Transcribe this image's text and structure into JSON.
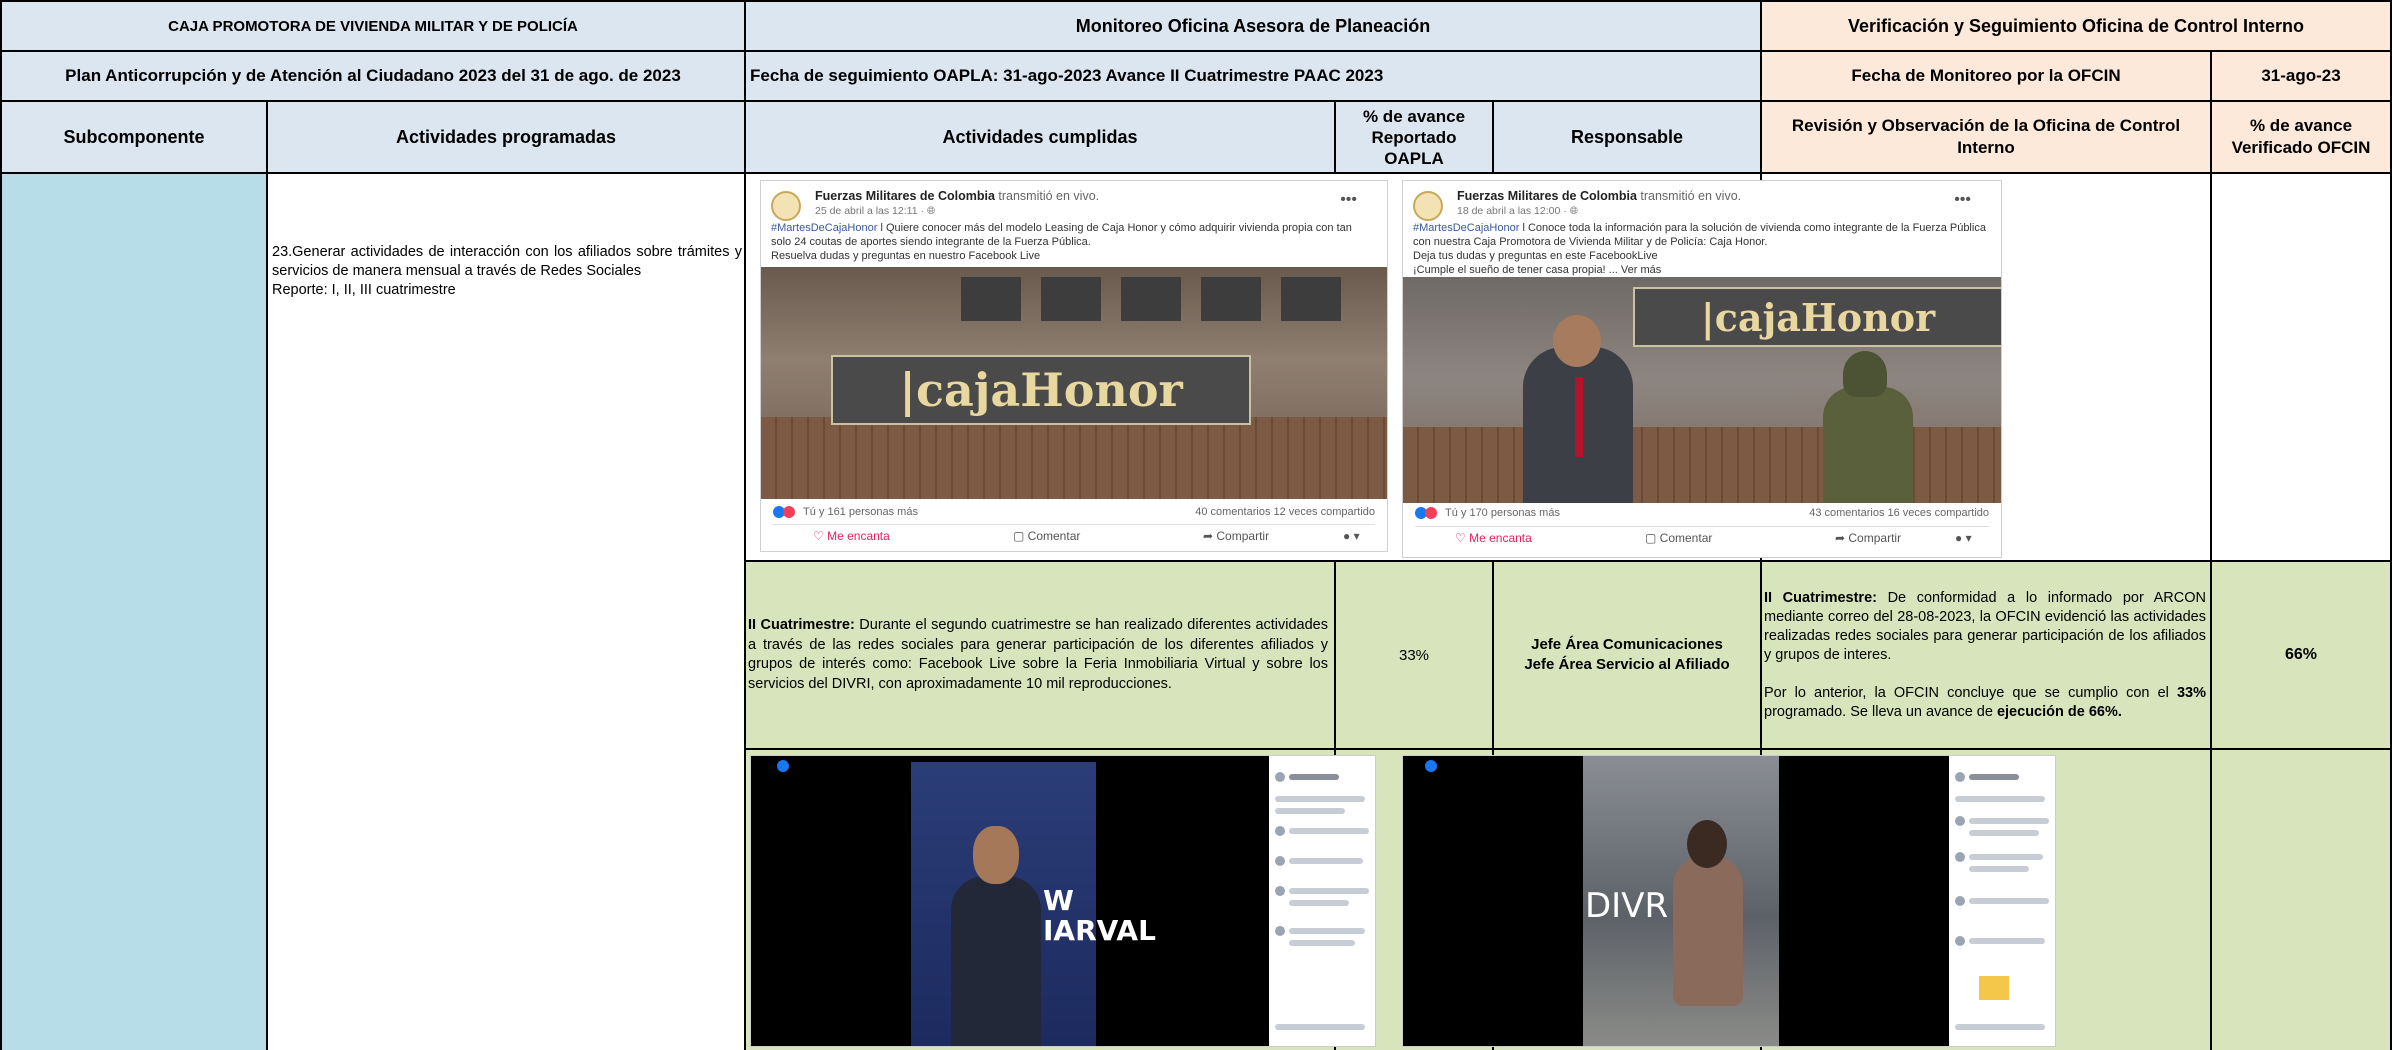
{
  "header": {
    "org": "CAJA PROMOTORA DE VIVIENDA MILITAR Y DE POLICÍA",
    "monitoring": "Monitoreo Oficina Asesora de Planeación",
    "verification": "Verificación y Seguimiento Oficina de Control Interno",
    "plan": "Plan Anticorrupción y de Atención al Ciudadano  2023  del 31 de ago. de 2023",
    "fecha_seguimiento": "Fecha de seguimiento OAPLA:   31-ago-2023 Avance II Cuatrimestre PAAC 2023",
    "fecha_monitoreo": "Fecha de Monitoreo por la OFCIN",
    "fecha_monitoreo_value": "31-ago-23"
  },
  "columns": {
    "subcomponente": "Subcomponente",
    "actividades_programadas": "Actividades programadas",
    "actividades_cumplidas": "Actividades cumplidas",
    "avance_reportado": "% de avance Reportado OAPLA",
    "responsable": "Responsable",
    "revision": "Revisión y Observación de la Oficina de Control Interno",
    "avance_verificado": "% de avance Verificado OFCIN"
  },
  "row": {
    "actividad_programada_line1": "23.Generar actividades de interacción con los afiliados sobre trámites y servicios de manera mensual a través de Redes Sociales",
    "actividad_programada_line2": "Reporte: I, II, III cuatrimestre",
    "cumplidas_label": "II Cuatrimestre:",
    "cumplidas_text": " Durante el segundo cuatrimestre se han realizado diferentes actividades a través de las redes sociales  para generar participación de los diferentes afiliados y grupos de interés como: Facebook Live sobre la Feria Inmobiliaria Virtual y sobre los servicios del DIVRI, con aproximadamente 10 mil reproducciones.",
    "avance_reportado": "33%",
    "responsable_1": "Jefe Área Comunicaciones",
    "responsable_2": "Jefe Área Servicio al Afiliado",
    "revision_label": "II Cuatrimestre:",
    "revision_text": " De conformidad a lo informado por  ARCON mediante correo del  28-08-2023, la OFCIN evidenció las actividades realizadas  redes sociales  para  generar participación de los afiliados y grupos de interes.",
    "revision_text2_a": "Por lo anterior, la OFCIN concluye que se cumplio con el ",
    "revision_text2_b": "33%",
    "revision_text2_c": " programado. Se lleva un avance  de  ",
    "revision_text2_d": "ejecución de 66%.",
    "avance_verificado": "66%"
  },
  "posts": [
    {
      "page": "Fuerzas Militares de Colombia",
      "action": " transmitió en vivo.",
      "date": "25 de abril a las 12:11 · ",
      "hashtag": "#MartesDeCajaHonor",
      "text": " l Quiere conocer más del modelo Leasing de Caja Honor y cómo adquirir vivienda propia con tan solo 24 coutas de aportes siendo integrante de la Fuerza Pública.",
      "text2": "Resuelva dudas y preguntas en nuestro Facebook Live",
      "text3": "",
      "sign": "|cajaHonor",
      "reactions": "Tú y 161 personas más",
      "counts": "40 comentarios   12 veces compartido",
      "like": "Me encanta",
      "comment": "Comentar",
      "share": "Compartir"
    },
    {
      "page": "Fuerzas Militares de Colombia",
      "action": " transmitió en vivo.",
      "date": "18 de abril a las 12:00 · ",
      "hashtag": "#MartesDeCajaHonor",
      "text": " l Conoce toda la información para la solución de vivienda como integrante de la Fuerza Pública con nuestra Caja Promotora de Vivienda Militar y de Policía: Caja Honor.",
      "text2": "Deja tus dudas y preguntas en este FacebookLive",
      "text3": "¡Cumple el sueño de tener casa propia! ... Ver más",
      "sign": "|cajaHonor",
      "reactions": "Tú y 170 personas más",
      "counts": "43 comentarios   16 veces compartido",
      "like": "Me encanta",
      "comment": "Comentar",
      "share": "Compartir"
    }
  ],
  "videos": [
    {
      "banner": "W\nIARVAL"
    },
    {
      "banner": "DIVR"
    }
  ]
}
